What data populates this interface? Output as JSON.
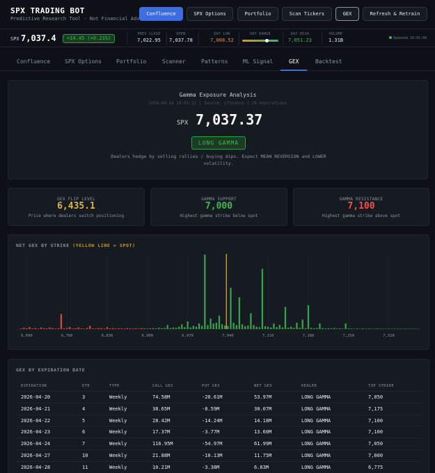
{
  "brand": {
    "title": "SPX TRADING BOT",
    "subtitle": "Predictive Research Tool - Not Financial Advice"
  },
  "nav": [
    "Confluence",
    "SPX Options",
    "Portfolio",
    "Scan Tickers",
    "GEX",
    "Refresh & Retrain"
  ],
  "ticker": {
    "symbol": "SPX",
    "price": "7,037.4",
    "change": "+14.45 (+0.21%)",
    "stats": [
      {
        "label": "PREV CLOSE",
        "value": "7,022.95",
        "color": "#e6edf3"
      },
      {
        "label": "OPEN",
        "value": "7,037.78",
        "color": "#e6edf3"
      },
      {
        "label": "DAY LOW",
        "value": "7,008.52",
        "color": "#f0883e"
      },
      {
        "label": "DAY RANGE",
        "value": "",
        "color": "#e6edf3"
      },
      {
        "label": "DAY HIGH",
        "value": "7,051.23",
        "color": "#3fb950"
      },
      {
        "label": "VOLUME",
        "value": "1.31B",
        "color": "#e6edf3"
      }
    ],
    "day_range_position": 0.68,
    "updated": "Updated 10:01:08"
  },
  "tabs": [
    "Confluence",
    "SPX Options",
    "Portfolio",
    "Scanner",
    "Patterns",
    "ML Signal",
    "GEX",
    "Backtest"
  ],
  "active_tab": "GEX",
  "hero": {
    "title": "Gamma Exposure Analysis",
    "meta": "2026-04-16 10:01:11 | Source: yfinance | 24 expirations",
    "symbol": "SPX",
    "price": "7,037.37",
    "regime": "LONG GAMMA",
    "description": "Dealers hedge by selling rallies / buying dips. Expect MEAN REVERSION and LOWER volatility."
  },
  "stats": [
    {
      "label": "GEX FLIP LEVEL",
      "value": "6,435.1",
      "color": "#e3b341",
      "desc": "Price where dealers switch positioning"
    },
    {
      "label": "GAMMA SUPPORT",
      "value": "7,000",
      "color": "#3fb950",
      "desc": "Highest gamma strike below spot"
    },
    {
      "label": "GAMMA RESISTANCE",
      "value": "7,100",
      "color": "#f85149",
      "desc": "Highest gamma strike above spot"
    }
  ],
  "chart_section": {
    "title": "NET GEX BY STRIKE",
    "note": "(YELLOW LINE = SPOT)"
  },
  "chart_data": {
    "type": "bar",
    "title": "NET GEX BY STRIKE (YELLOW LINE = SPOT)",
    "x_tick_labels": [
      "6,690",
      "6,760",
      "6,830",
      "6,900",
      "6,970",
      "7,040",
      "7,110",
      "7,180",
      "7,250",
      "7,320"
    ],
    "xlim": [
      6675,
      7375
    ],
    "spot": 7037.37,
    "positive_color": "#3fb950",
    "negative_color": "#f85149",
    "spot_color": "#e3b341",
    "x": [
      6680,
      6685,
      6690,
      6695,
      6700,
      6705,
      6710,
      6715,
      6720,
      6725,
      6730,
      6735,
      6740,
      6745,
      6750,
      6755,
      6760,
      6765,
      6770,
      6775,
      6780,
      6785,
      6790,
      6795,
      6800,
      6805,
      6810,
      6815,
      6820,
      6825,
      6830,
      6835,
      6840,
      6845,
      6850,
      6855,
      6860,
      6865,
      6870,
      6875,
      6880,
      6885,
      6890,
      6895,
      6900,
      6905,
      6910,
      6915,
      6920,
      6925,
      6930,
      6935,
      6940,
      6945,
      6950,
      6955,
      6960,
      6965,
      6970,
      6975,
      6980,
      6985,
      6990,
      6995,
      7000,
      7005,
      7010,
      7015,
      7020,
      7025,
      7030,
      7035,
      7040,
      7045,
      7050,
      7055,
      7060,
      7065,
      7070,
      7075,
      7080,
      7085,
      7090,
      7095,
      7100,
      7105,
      7110,
      7115,
      7120,
      7125,
      7130,
      7135,
      7140,
      7145,
      7150,
      7155,
      7160,
      7165,
      7170,
      7175,
      7180,
      7185,
      7190,
      7195,
      7200,
      7205,
      7210,
      7215,
      7220,
      7225,
      7230,
      7235,
      7240,
      7245,
      7250,
      7255,
      7260,
      7265,
      7270,
      7275,
      7280,
      7285,
      7290,
      7295,
      7300,
      7305,
      7310,
      7315,
      7320,
      7325,
      7330,
      7335,
      7340,
      7345,
      7350,
      7355,
      7360,
      7365,
      7370
    ],
    "values": [
      -0.3,
      -0.8,
      -0.5,
      -1.2,
      -0.4,
      -0.6,
      -0.3,
      -0.9,
      -0.5,
      -0.4,
      -1.0,
      -0.6,
      -0.3,
      -0.5,
      -9.5,
      -0.4,
      -0.6,
      -1.3,
      -0.3,
      -0.5,
      -1.0,
      -0.4,
      -0.3,
      -0.6,
      -2.0,
      -0.4,
      -0.3,
      -0.7,
      -0.5,
      -0.3,
      -1.2,
      -0.4,
      -0.6,
      -0.3,
      -0.5,
      -0.4,
      -0.3,
      -0.6,
      -0.4,
      -0.3,
      -0.5,
      -0.3,
      -0.6,
      0.4,
      0.3,
      -0.5,
      0.6,
      0.4,
      0.8,
      0.5,
      0.7,
      2.5,
      0.6,
      1.0,
      0.8,
      1.5,
      3.0,
      1.2,
      4.8,
      1.0,
      2.0,
      1.5,
      3.5,
      2.0,
      47.0,
      2.5,
      6.5,
      3.5,
      4.0,
      8.5,
      3.0,
      2.2,
      2.0,
      26.0,
      4.0,
      2.5,
      20.0,
      3.0,
      1.8,
      2.2,
      10.0,
      2.5,
      1.5,
      1.2,
      38.0,
      1.8,
      1.5,
      1.0,
      3.5,
      1.2,
      2.5,
      1.0,
      14.0,
      0.8,
      1.5,
      0.7,
      4.0,
      0.8,
      6.0,
      0.6,
      15.0,
      0.7,
      0.5,
      0.6,
      3.5,
      0.5,
      0.4,
      0.5,
      0.4,
      0.6,
      0.3,
      0.4,
      0.3,
      3.5,
      0.4,
      0.3,
      0.2,
      0.3,
      0.2,
      0.3,
      0.2,
      0.3,
      0.2,
      0.2,
      0.3,
      0.2,
      0.2,
      0.2,
      0.2,
      0.2,
      0.2,
      0.2,
      0.2,
      0.2,
      0.2,
      0.2,
      0.2,
      0.2,
      0.2
    ]
  },
  "exp_table": {
    "title": "GEX BY EXPIRATION DATE",
    "headers": [
      "EXPIRATION",
      "DTE",
      "TYPE",
      "CALL GEX",
      "PUT GEX",
      "NET GEX",
      "DEALER",
      "TOP STRIKE"
    ],
    "rows": [
      [
        "2026-04-20",
        "3",
        "Weekly",
        "74.58M",
        "-20.61M",
        "53.97M",
        "LONG GAMMA",
        "7,050"
      ],
      [
        "2026-04-21",
        "4",
        "Weekly",
        "38.65M",
        "-8.59M",
        "30.07M",
        "LONG GAMMA",
        "7,175"
      ],
      [
        "2026-04-22",
        "5",
        "Weekly",
        "28.42M",
        "-14.24M",
        "14.18M",
        "LONG GAMMA",
        "7,100"
      ],
      [
        "2026-04-23",
        "6",
        "Weekly",
        "17.37M",
        "-3.77M",
        "13.60M",
        "LONG GAMMA",
        "7,100"
      ],
      [
        "2026-04-24",
        "7",
        "Weekly",
        "116.95M",
        "-54.97M",
        "61.99M",
        "LONG GAMMA",
        "7,050"
      ],
      [
        "2026-04-27",
        "10",
        "Weekly",
        "21.88M",
        "-10.13M",
        "11.75M",
        "LONG GAMMA",
        "7,000"
      ],
      [
        "2026-04-28",
        "11",
        "Weekly",
        "10.21M",
        "-3.38M",
        "6.83M",
        "LONG GAMMA",
        "6,775"
      ]
    ]
  }
}
